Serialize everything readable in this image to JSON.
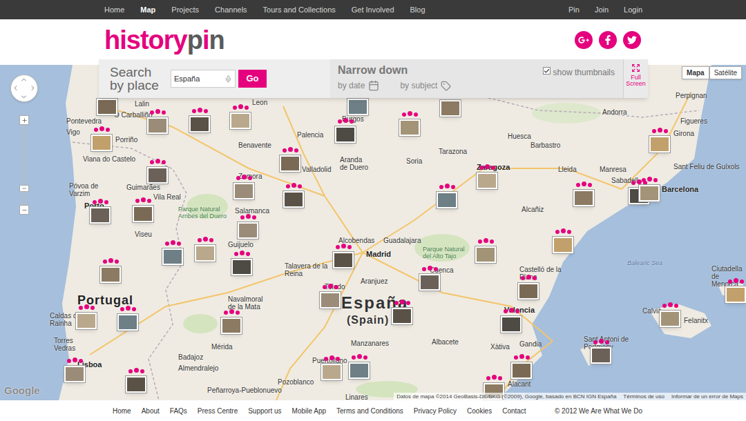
{
  "nav": {
    "left": [
      {
        "label": "Home",
        "selected": false
      },
      {
        "label": "Map",
        "selected": true
      },
      {
        "label": "Projects",
        "selected": false
      },
      {
        "label": "Channels",
        "selected": false
      },
      {
        "label": "Tours and Collections",
        "selected": false
      },
      {
        "label": "Get Involved",
        "selected": false
      },
      {
        "label": "Blog",
        "selected": false
      }
    ],
    "right": [
      "Pin",
      "Join",
      "Login"
    ]
  },
  "logo": [
    "history",
    "p",
    "i",
    "n"
  ],
  "search": {
    "title": "Search by place",
    "value": "España",
    "button": "Go"
  },
  "filters": {
    "title": "Narrow down",
    "by_date": "by date",
    "by_subject": "by subject",
    "show_thumbnails": {
      "label": "show thumbnails",
      "checked": true
    },
    "fullscreen": "Full Screen"
  },
  "map_types": [
    {
      "label": "Mapa",
      "selected": true
    },
    {
      "label": "Satélite",
      "selected": false
    }
  ],
  "map_labels": [
    {
      "text": "Lalin",
      "kind": "city"
    },
    {
      "text": "O Carballiño",
      "kind": "city"
    },
    {
      "text": "Leon",
      "kind": "city"
    },
    {
      "text": "Pontevedra",
      "kind": "city"
    },
    {
      "text": "Vigo",
      "kind": "city"
    },
    {
      "text": "Porriño",
      "kind": "city"
    },
    {
      "text": "Viana do Castelo",
      "kind": "city"
    },
    {
      "text": "Benavente",
      "kind": "city"
    },
    {
      "text": "Palencia",
      "kind": "city"
    },
    {
      "text": "Aranda de Duero",
      "kind": "city"
    },
    {
      "text": "Soria",
      "kind": "city"
    },
    {
      "text": "Huesca",
      "kind": "city"
    },
    {
      "text": "Barbastro",
      "kind": "city"
    },
    {
      "text": "Tarazona",
      "kind": "city"
    },
    {
      "text": "Zaragoza",
      "kind": "major"
    },
    {
      "text": "Andorra",
      "kind": "city"
    },
    {
      "text": "Perpignan",
      "kind": "city"
    },
    {
      "text": "Figueres",
      "kind": "city"
    },
    {
      "text": "Girona",
      "kind": "city"
    },
    {
      "text": "Sant Feliu de Guíxols",
      "kind": "city"
    },
    {
      "text": "Lleida",
      "kind": "city"
    },
    {
      "text": "Manresa",
      "kind": "city"
    },
    {
      "text": "Sabadell",
      "kind": "city"
    },
    {
      "text": "Barcelona",
      "kind": "major"
    },
    {
      "text": "Guimarães",
      "kind": "city"
    },
    {
      "text": "Vila Real",
      "kind": "city"
    },
    {
      "text": "Póvoa de Varzim",
      "kind": "city"
    },
    {
      "text": "Porto",
      "kind": "major"
    },
    {
      "text": "Viseu",
      "kind": "city"
    },
    {
      "text": "Zamora",
      "kind": "city"
    },
    {
      "text": "Salamanca",
      "kind": "city"
    },
    {
      "text": "Parque Natural Arribes del Duero",
      "kind": "park"
    },
    {
      "text": "Guijuelo",
      "kind": "city"
    },
    {
      "text": "Alcañiz",
      "kind": "city"
    },
    {
      "text": "Alcobendas",
      "kind": "city"
    },
    {
      "text": "Guadalajara",
      "kind": "city"
    },
    {
      "text": "Madrid",
      "kind": "major"
    },
    {
      "text": "Parque Natural del Alto Tajo",
      "kind": "park"
    },
    {
      "text": "Talavera de la Reina",
      "kind": "city"
    },
    {
      "text": "Aranjuez",
      "kind": "city"
    },
    {
      "text": "Toledo",
      "kind": "city"
    },
    {
      "text": "Cuenca",
      "kind": "city"
    },
    {
      "text": "Castelló de la Plana",
      "kind": "city"
    },
    {
      "text": "Balearic Sea",
      "kind": "water"
    },
    {
      "text": "Ciutadella de Menorca",
      "kind": "city"
    },
    {
      "text": "Valencia",
      "kind": "major"
    },
    {
      "text": "Xàtiva",
      "kind": "city"
    },
    {
      "text": "Gandia",
      "kind": "city"
    },
    {
      "text": "Albacete",
      "kind": "city"
    },
    {
      "text": "Manzanares",
      "kind": "city"
    },
    {
      "text": "Mérida",
      "kind": "city"
    },
    {
      "text": "Badajoz",
      "kind": "city"
    },
    {
      "text": "Almendralejo",
      "kind": "city"
    },
    {
      "text": "Caldas da Rainha",
      "kind": "city"
    },
    {
      "text": "Torres Vedras",
      "kind": "city"
    },
    {
      "text": "Lisboa",
      "kind": "major"
    },
    {
      "text": "Puertollano",
      "kind": "city"
    },
    {
      "text": "Pozoblanco",
      "kind": "city"
    },
    {
      "text": "Sant Antoni de Portmany",
      "kind": "city"
    },
    {
      "text": "Felanitx",
      "kind": "city"
    },
    {
      "text": "Calvià",
      "kind": "city"
    },
    {
      "text": "Alacant",
      "kind": "city"
    },
    {
      "text": "Linares",
      "kind": "city"
    },
    {
      "text": "Navalmoral de la Mata",
      "kind": "city"
    },
    {
      "text": "Peñarroya-Pueblonuevo",
      "kind": "city"
    },
    {
      "text": "Portugal",
      "kind": "country"
    },
    {
      "text": "España",
      "kind": "spain"
    },
    {
      "text": "(Spain)",
      "kind": "spainsub"
    },
    {
      "text": "Burgos",
      "kind": "city"
    },
    {
      "text": "Valladolid",
      "kind": "city"
    }
  ],
  "pins": [
    {
      "kind": "thumbnail"
    },
    {
      "kind": "thumbnail"
    },
    {
      "kind": "thumbnail"
    },
    {
      "kind": "thumbnail"
    },
    {
      "kind": "thumbnail"
    },
    {
      "kind": "thumbnail"
    },
    {
      "kind": "thumbnail"
    },
    {
      "kind": "thumbnail"
    },
    {
      "kind": "thumbnail"
    },
    {
      "kind": "thumbnail"
    },
    {
      "kind": "thumbnail"
    },
    {
      "kind": "thumbnail"
    },
    {
      "kind": "thumbnail"
    },
    {
      "kind": "thumbnail"
    },
    {
      "kind": "thumbnail"
    },
    {
      "kind": "thumbnail"
    },
    {
      "kind": "thumbnail"
    },
    {
      "kind": "thumbnail"
    },
    {
      "kind": "thumbnail"
    },
    {
      "kind": "thumbnail"
    },
    {
      "kind": "thumbnail"
    },
    {
      "kind": "thumbnail"
    },
    {
      "kind": "thumbnail"
    },
    {
      "kind": "thumbnail"
    },
    {
      "kind": "thumbnail"
    },
    {
      "kind": "thumbnail"
    },
    {
      "kind": "thumbnail"
    },
    {
      "kind": "thumbnail"
    },
    {
      "kind": "thumbnail"
    },
    {
      "kind": "thumbnail"
    },
    {
      "kind": "thumbnail"
    },
    {
      "kind": "thumbnail"
    },
    {
      "kind": "thumbnail"
    },
    {
      "kind": "thumbnail"
    },
    {
      "kind": "thumbnail"
    },
    {
      "kind": "thumbnail"
    },
    {
      "kind": "thumbnail"
    },
    {
      "kind": "thumbnail"
    },
    {
      "kind": "thumbnail"
    },
    {
      "kind": "thumbnail"
    },
    {
      "kind": "thumbnail"
    },
    {
      "kind": "thumbnail"
    },
    {
      "kind": "thumbnail"
    },
    {
      "kind": "thumbnail"
    },
    {
      "kind": "thumbnail"
    },
    {
      "kind": "thumbnail"
    }
  ],
  "attribution": {
    "brand": "Google",
    "data": "Datos de mapa ©2014 GeoBasis-DE/BKG (©2009), Google, basado en BCN IGN España",
    "terms": "Términos de uso",
    "report": "Informar de un error de Maps"
  },
  "footer": {
    "links": [
      "Home",
      "About",
      "FAQs",
      "Press Centre",
      "Support us",
      "Mobile App",
      "Terms and Conditions",
      "Privacy Policy",
      "Cookies",
      "Contact"
    ],
    "copyright": "© 2012 We Are What We Do"
  }
}
